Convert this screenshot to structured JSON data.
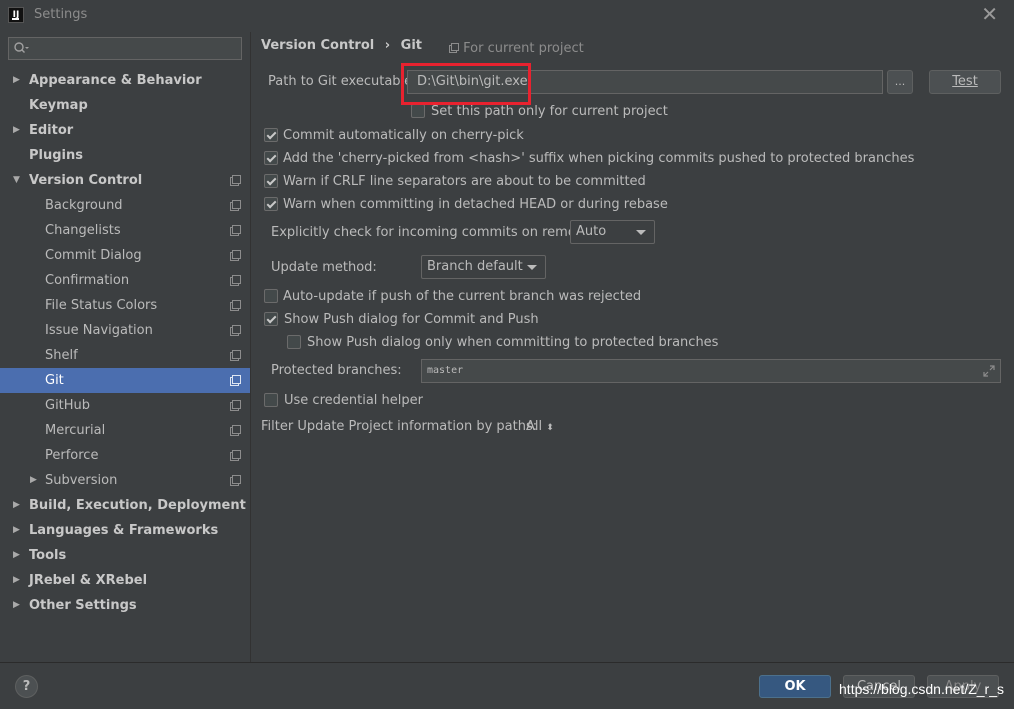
{
  "window": {
    "title": "Settings",
    "close_glyph": "✕"
  },
  "search": {
    "placeholder": ""
  },
  "sidebar": {
    "items": [
      {
        "label": "Appearance & Behavior",
        "level": 0,
        "expander": "collapsed",
        "project": false,
        "selected": false
      },
      {
        "label": "Keymap",
        "level": 0,
        "expander": "none",
        "project": false,
        "selected": false
      },
      {
        "label": "Editor",
        "level": 0,
        "expander": "collapsed",
        "project": false,
        "selected": false
      },
      {
        "label": "Plugins",
        "level": 0,
        "expander": "none",
        "project": false,
        "selected": false
      },
      {
        "label": "Version Control",
        "level": 0,
        "expander": "expanded",
        "project": true,
        "selected": false
      },
      {
        "label": "Background",
        "level": 1,
        "expander": "none",
        "project": true,
        "selected": false
      },
      {
        "label": "Changelists",
        "level": 1,
        "expander": "none",
        "project": true,
        "selected": false
      },
      {
        "label": "Commit Dialog",
        "level": 1,
        "expander": "none",
        "project": true,
        "selected": false
      },
      {
        "label": "Confirmation",
        "level": 1,
        "expander": "none",
        "project": true,
        "selected": false
      },
      {
        "label": "File Status Colors",
        "level": 1,
        "expander": "none",
        "project": true,
        "selected": false
      },
      {
        "label": "Issue Navigation",
        "level": 1,
        "expander": "none",
        "project": true,
        "selected": false
      },
      {
        "label": "Shelf",
        "level": 1,
        "expander": "none",
        "project": true,
        "selected": false
      },
      {
        "label": "Git",
        "level": 1,
        "expander": "none",
        "project": true,
        "selected": true
      },
      {
        "label": "GitHub",
        "level": 1,
        "expander": "none",
        "project": true,
        "selected": false
      },
      {
        "label": "Mercurial",
        "level": 1,
        "expander": "none",
        "project": true,
        "selected": false
      },
      {
        "label": "Perforce",
        "level": 1,
        "expander": "none",
        "project": true,
        "selected": false
      },
      {
        "label": "Subversion",
        "level": 1,
        "expander": "collapsed",
        "project": true,
        "selected": false
      },
      {
        "label": "Build, Execution, Deployment",
        "level": 0,
        "expander": "collapsed",
        "project": false,
        "selected": false
      },
      {
        "label": "Languages & Frameworks",
        "level": 0,
        "expander": "collapsed",
        "project": false,
        "selected": false
      },
      {
        "label": "Tools",
        "level": 0,
        "expander": "collapsed",
        "project": false,
        "selected": false
      },
      {
        "label": "JRebel & XRebel",
        "level": 0,
        "expander": "collapsed",
        "project": false,
        "selected": false
      },
      {
        "label": "Other Settings",
        "level": 0,
        "expander": "collapsed",
        "project": false,
        "selected": false
      }
    ]
  },
  "breadcrumb": {
    "parent": "Version Control",
    "separator": "›",
    "current": "Git",
    "scope_note": "For current project"
  },
  "git": {
    "path_label": "Path to Git executable:",
    "path_value": "D:\\Git\\bin\\git.exe",
    "browse_label": "...",
    "test_label": "Test",
    "current_project_only": {
      "label": "Set this path only for current project",
      "checked": false
    },
    "options": [
      {
        "label": "Commit automatically on cherry-pick",
        "checked": true
      },
      {
        "label": "Add the 'cherry-picked from <hash>' suffix when picking commits pushed to protected branches",
        "checked": true
      },
      {
        "label": "Warn if CRLF line separators are about to be committed",
        "checked": true
      },
      {
        "label": "Warn when committing in detached HEAD or during rebase",
        "checked": true
      }
    ],
    "incoming_label": "Explicitly check for incoming commits on remotes:",
    "incoming_value": "Auto",
    "update_label": "Update method:",
    "update_value": "Branch default",
    "auto_update": {
      "label": "Auto-update if push of the current branch was rejected",
      "checked": false
    },
    "show_push": {
      "label": "Show Push dialog for Commit and Push",
      "checked": true
    },
    "show_push_protected": {
      "label": "Show Push dialog only when committing to protected branches",
      "checked": false
    },
    "protected_label": "Protected branches:",
    "protected_value": "master",
    "credential": {
      "label": "Use credential helper",
      "checked": false
    },
    "filter_label": "Filter Update Project information by paths:",
    "filter_value": "All"
  },
  "footer": {
    "help_label": "?",
    "ok_label": "OK",
    "cancel_label": "Cancel",
    "apply_label": "Apply"
  },
  "watermark": "https://blog.csdn.net/Z_r_s",
  "colors": {
    "background": "#3c3f41",
    "selection": "#4b6eaf",
    "highlight_box": "#e8222f",
    "ok_button": "#365880"
  }
}
